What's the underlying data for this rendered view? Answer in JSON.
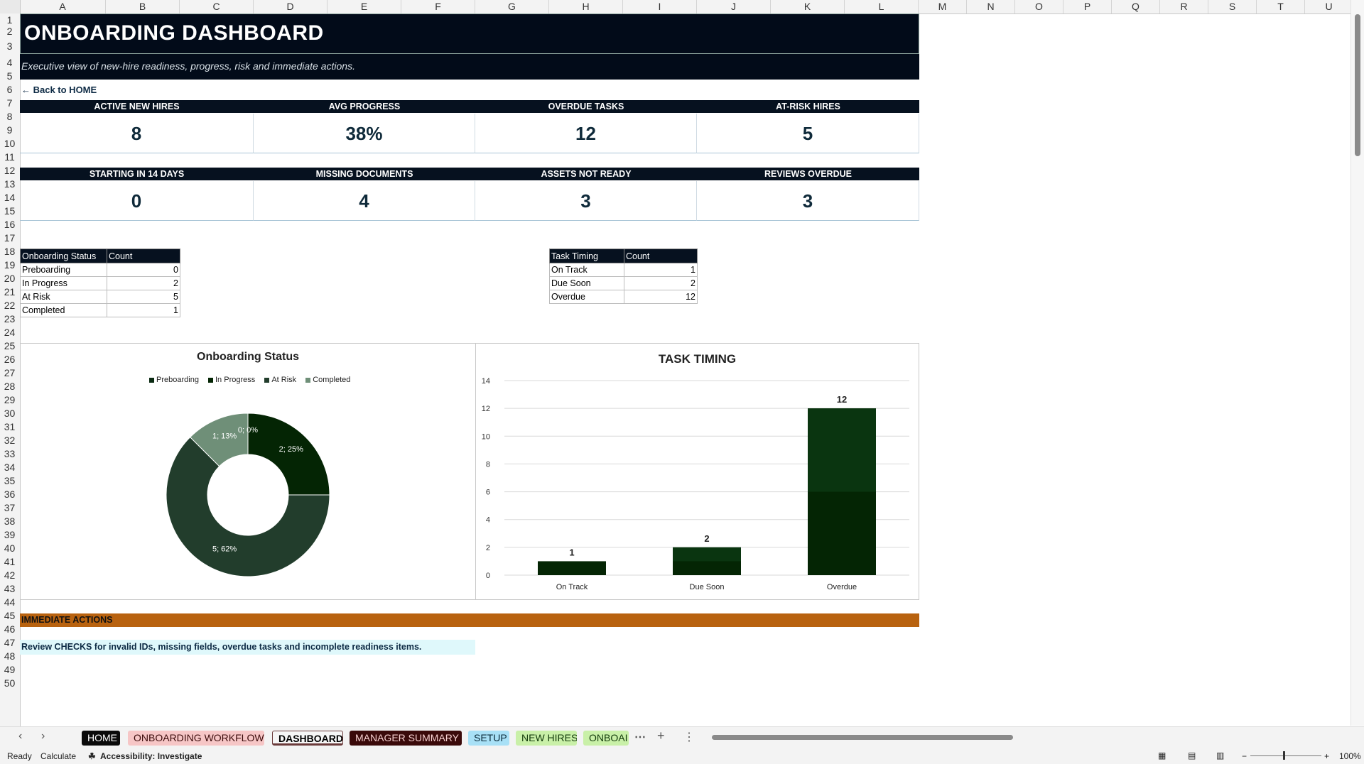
{
  "columns": [
    "A",
    "B",
    "C",
    "D",
    "E",
    "F",
    "G",
    "H",
    "I",
    "J",
    "K",
    "L",
    "M",
    "N",
    "O",
    "P",
    "Q",
    "R",
    "S",
    "T",
    "U"
  ],
  "rows": [
    "1",
    "2",
    "3",
    "4",
    "5",
    "6",
    "7",
    "8",
    "9",
    "10",
    "11",
    "12",
    "13",
    "14",
    "15",
    "16",
    "17",
    "18",
    "19",
    "20",
    "21",
    "22",
    "23",
    "24",
    "25",
    "26",
    "27",
    "28",
    "29",
    "30",
    "31",
    "32",
    "33",
    "34",
    "35",
    "36",
    "37",
    "38",
    "39",
    "40",
    "41",
    "42",
    "43",
    "44",
    "45",
    "46",
    "47",
    "48",
    "49",
    "50"
  ],
  "header": {
    "title": "ONBOARDING DASHBOARD",
    "subtitle": "Executive view of new-hire readiness, progress, risk and immediate actions.",
    "back_link": "← Back to HOME"
  },
  "kpis_row1": [
    {
      "label": "ACTIVE NEW HIRES",
      "value": "8"
    },
    {
      "label": "AVG PROGRESS",
      "value": "38%"
    },
    {
      "label": "OVERDUE TASKS",
      "value": "12"
    },
    {
      "label": "AT-RISK HIRES",
      "value": "5"
    }
  ],
  "kpis_row2": [
    {
      "label": "STARTING IN 14 DAYS",
      "value": "0"
    },
    {
      "label": "MISSING DOCUMENTS",
      "value": "4"
    },
    {
      "label": "ASSETS NOT READY",
      "value": "3"
    },
    {
      "label": "REVIEWS OVERDUE",
      "value": "3"
    }
  ],
  "status_table": {
    "headers": [
      "Onboarding Status",
      "Count"
    ],
    "rows": [
      [
        "Preboarding",
        "0"
      ],
      [
        "In Progress",
        "2"
      ],
      [
        "At Risk",
        "5"
      ],
      [
        "Completed",
        "1"
      ]
    ]
  },
  "timing_table": {
    "headers": [
      "Task Timing",
      "Count"
    ],
    "rows": [
      [
        "On Track",
        "1"
      ],
      [
        "Due Soon",
        "2"
      ],
      [
        "Overdue",
        "12"
      ]
    ]
  },
  "chart_data": [
    {
      "type": "pie",
      "title": "Onboarding Status",
      "categories": [
        "Preboarding",
        "In Progress",
        "At Risk",
        "Completed"
      ],
      "values": [
        0,
        2,
        5,
        1
      ],
      "data_labels": [
        "0; 0%",
        "2; 25%",
        "5; 62%",
        "1; 13%"
      ],
      "colors": [
        "#0a2a12",
        "#042504",
        "#223d2c",
        "#6f8f78"
      ],
      "legend_position": "top"
    },
    {
      "type": "bar",
      "title": "TASK TIMING",
      "categories": [
        "On Track",
        "Due Soon",
        "Overdue"
      ],
      "values": [
        1,
        2,
        12
      ],
      "ylim": [
        0,
        14
      ],
      "yticks": [
        "0",
        "2",
        "4",
        "6",
        "8",
        "10",
        "12",
        "14"
      ],
      "grid": true,
      "colors": [
        "#042504",
        "#0a3510"
      ]
    }
  ],
  "actions": {
    "title": "IMMEDIATE ACTIONS",
    "note": "Review CHECKS for invalid IDs, missing fields, overdue tasks and incomplete readiness items."
  },
  "sheet_tabs": [
    {
      "label": "HOME",
      "bg": "#0a0a0a",
      "fg": "#ffffff"
    },
    {
      "label": "ONBOARDING WORKFLOW",
      "bg": "#f6c6c6",
      "fg": "#3a0a0a"
    },
    {
      "label": "DASHBOARD",
      "bg": "#f6f6f6",
      "fg": "#000000"
    },
    {
      "label": "MANAGER SUMMARY",
      "bg": "#3a0a0a",
      "fg": "#f6d0d0"
    },
    {
      "label": "SETUP",
      "bg": "#a8e0f6",
      "fg": "#0a2a3a"
    },
    {
      "label": "NEW HIRES",
      "bg": "#c9f0a8",
      "fg": "#123a0a"
    },
    {
      "label": "ONBOAI",
      "bg": "#c9f0a8",
      "fg": "#123a0a"
    }
  ],
  "status_bar": {
    "ready": "Ready",
    "calculate": "Calculate",
    "accessibility": "Accessibility: Investigate",
    "zoom": "100%"
  }
}
